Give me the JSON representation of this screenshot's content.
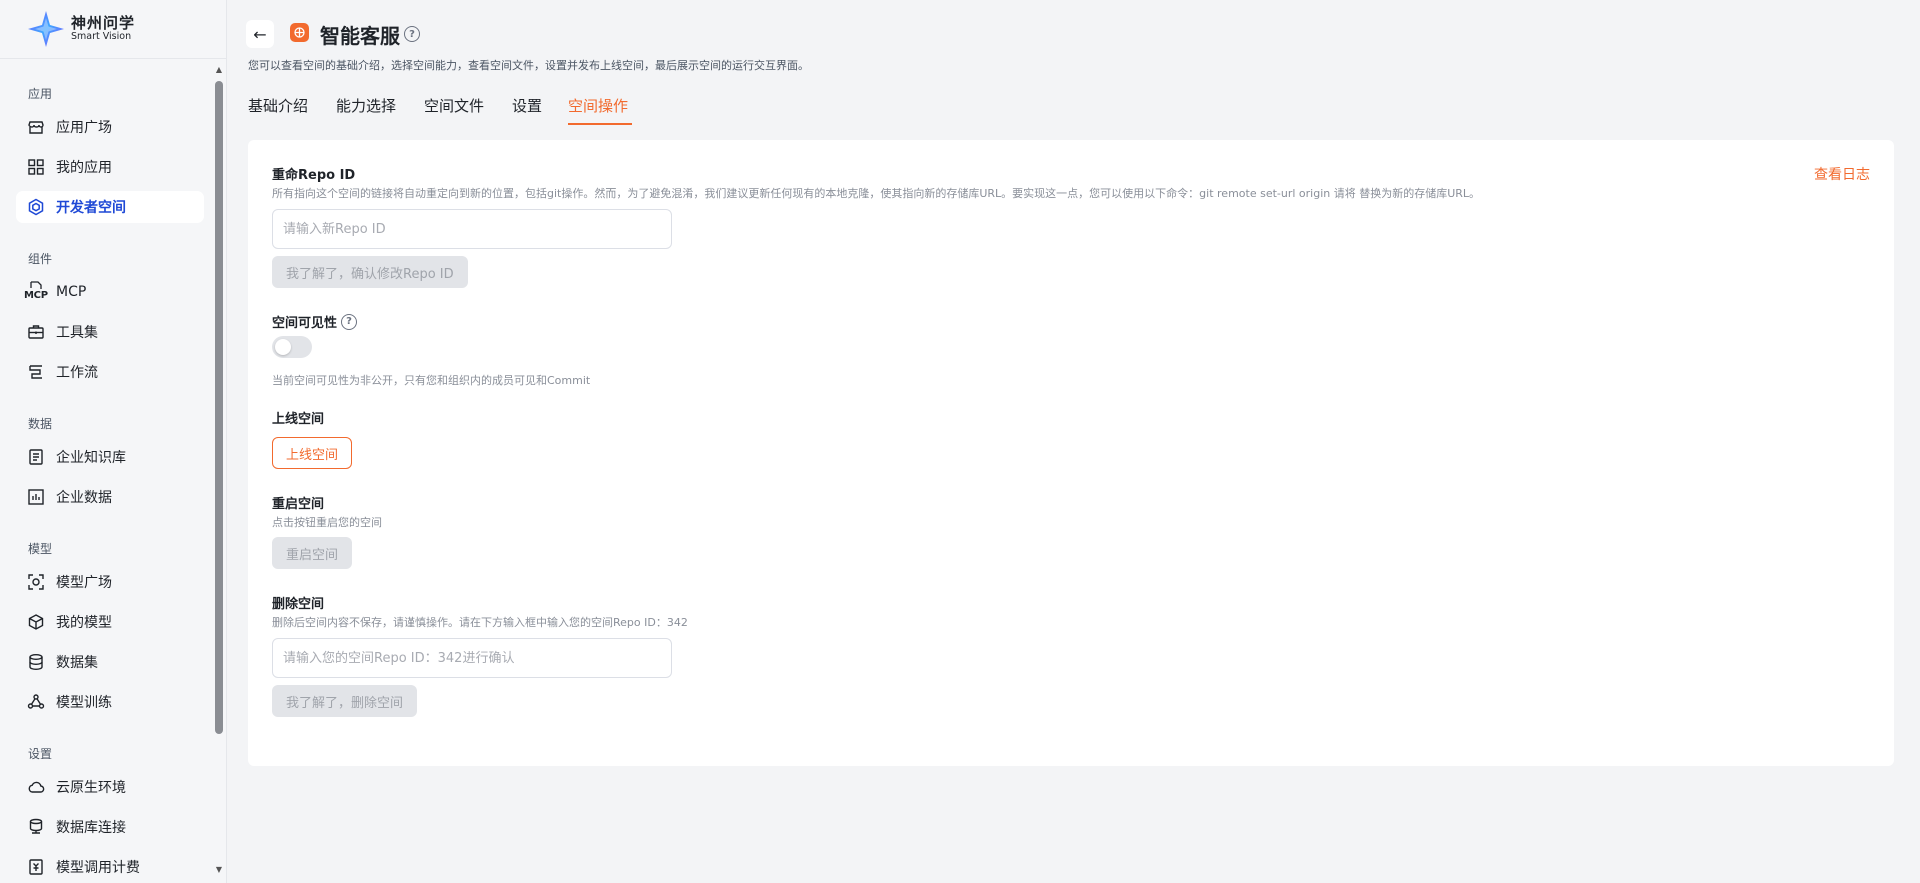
{
  "brand": {
    "name_cn": "神州问学",
    "name_en": "Smart Vision",
    "accent": "#f26a2e",
    "active_nav_color": "#1f49d6"
  },
  "sidebar": {
    "groups": [
      {
        "label": "应用",
        "items": [
          {
            "label": "应用广场",
            "icon": "store-icon"
          },
          {
            "label": "我的应用",
            "icon": "grid-icon"
          },
          {
            "label": "开发者空间",
            "icon": "cube-hex-icon",
            "active": true
          }
        ]
      },
      {
        "label": "组件",
        "items": [
          {
            "label": "MCP",
            "icon": "mcp-icon",
            "icon_text": "MCP"
          },
          {
            "label": "工具集",
            "icon": "toolbox-icon"
          },
          {
            "label": "工作流",
            "icon": "workflow-icon"
          }
        ]
      },
      {
        "label": "数据",
        "items": [
          {
            "label": "企业知识库",
            "icon": "document-icon"
          },
          {
            "label": "企业数据",
            "icon": "bar-chart-icon"
          }
        ]
      },
      {
        "label": "模型",
        "items": [
          {
            "label": "模型广场",
            "icon": "scan-icon"
          },
          {
            "label": "我的模型",
            "icon": "box-icon"
          },
          {
            "label": "数据集",
            "icon": "database-icon"
          },
          {
            "label": "模型训练",
            "icon": "training-icon"
          }
        ]
      },
      {
        "label": "设置",
        "items": [
          {
            "label": "云原生环境",
            "icon": "cloud-icon"
          },
          {
            "label": "数据库连接",
            "icon": "db-connect-icon"
          },
          {
            "label": "模型调用计费",
            "icon": "billing-icon"
          }
        ]
      }
    ]
  },
  "header": {
    "back_icon": "←",
    "title": "智能客服",
    "help_glyph": "?",
    "description": "您可以查看空间的基础介绍，选择空间能力，查看空间文件，设置并发布上线空间，最后展示空间的运行交互界面。"
  },
  "tabs": [
    {
      "label": "基础介绍"
    },
    {
      "label": "能力选择"
    },
    {
      "label": "空间文件"
    },
    {
      "label": "设置"
    },
    {
      "label": "空间操作",
      "active": true
    }
  ],
  "content": {
    "view_log": "查看日志",
    "rename": {
      "title": "重命Repo ID",
      "description": "所有指向这个空间的链接将自动重定向到新的位置，包括git操作。然而，为了避免混淆，我们建议更新任何现有的本地克隆，使其指向新的存储库URL。要实现这一点，您可以使用以下命令：git remote set-url origin 请将 替换为新的存储库URL。",
      "placeholder": "请输入新Repo ID",
      "button": "我了解了，确认修改Repo ID"
    },
    "visibility": {
      "title": "空间可见性",
      "enabled": false,
      "description": "当前空间可见性为非公开，只有您和组织内的成员可见和Commit"
    },
    "publish": {
      "title": "上线空间",
      "button": "上线空间"
    },
    "restart": {
      "title": "重启空间",
      "description": "点击按钮重启您的空间",
      "button": "重启空间"
    },
    "delete": {
      "title": "删除空间",
      "description": "删除后空间内容不保存，请谨慎操作。请在下方输入框中输入您的空间Repo ID：342",
      "placeholder": "请输入您的空间Repo ID：342进行确认",
      "button": "我了解了，删除空间"
    }
  }
}
